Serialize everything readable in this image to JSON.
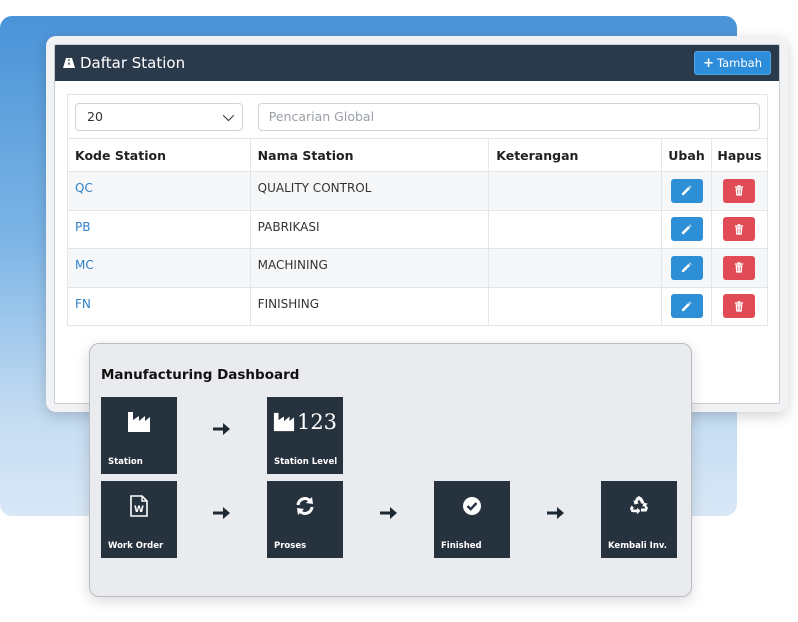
{
  "station_card": {
    "title": "Daftar Station",
    "add_button": "Tambah",
    "page_size": "20",
    "search_placeholder": "Pencarian Global",
    "columns": [
      "Kode Station",
      "Nama Station",
      "Keterangan",
      "Ubah",
      "Hapus"
    ],
    "rows": [
      {
        "code": "QC",
        "name": "QUALITY CONTROL",
        "note": ""
      },
      {
        "code": "PB",
        "name": "PABRIKASI",
        "note": ""
      },
      {
        "code": "MC",
        "name": "MACHINING",
        "note": ""
      },
      {
        "code": "FN",
        "name": "FINISHING",
        "note": ""
      }
    ],
    "colors": {
      "header": "#2b3a4a",
      "primary": "#2d8fd5",
      "danger": "#e04b55",
      "link": "#2e7fc8"
    }
  },
  "dashboard": {
    "title": "Manufacturing Dashboard",
    "tiles": [
      {
        "label": "Station",
        "icon": "factory-icon"
      },
      {
        "label": "Station Level",
        "icon": "factory-level-icon",
        "number": "123"
      },
      {
        "label": "Work Order",
        "icon": "word-document-icon"
      },
      {
        "label": "Proses",
        "icon": "sync-icon"
      },
      {
        "label": "Finished",
        "icon": "check-circle-icon"
      },
      {
        "label": "Kembali Inv.",
        "icon": "recycle-icon"
      }
    ],
    "tile_color": "#27323f"
  }
}
